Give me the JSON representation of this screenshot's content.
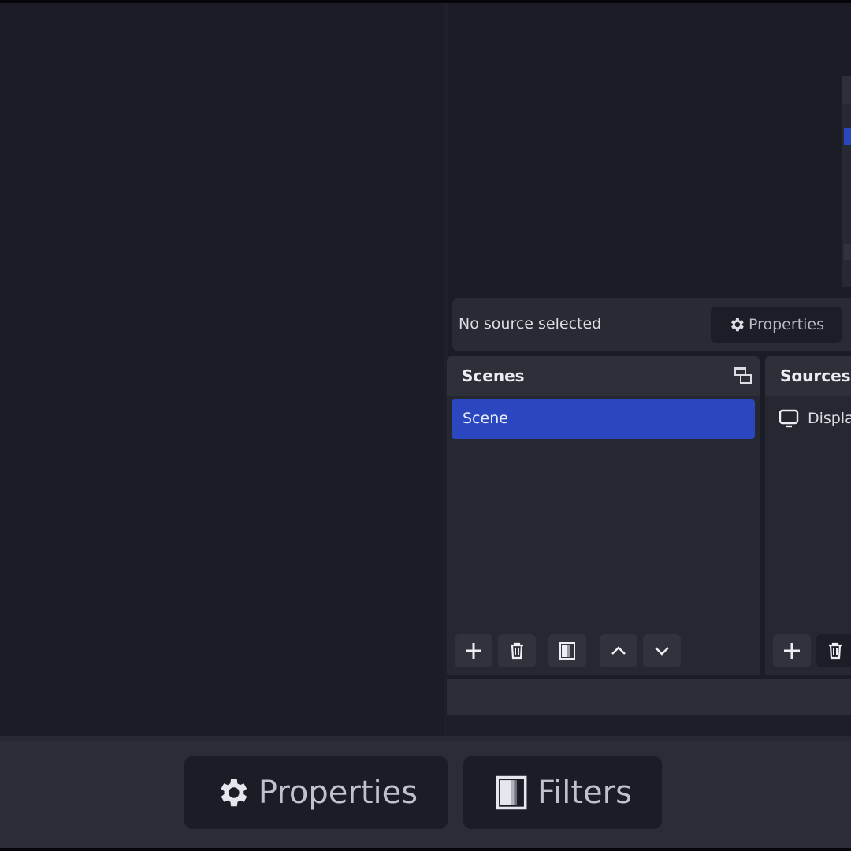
{
  "source_toolbar": {
    "status_text": "No source selected",
    "properties_label": "Properties"
  },
  "scenes_dock": {
    "title": "Scenes",
    "items": [
      {
        "label": "Scene",
        "selected": true
      }
    ],
    "toolbar": [
      "add",
      "remove",
      "filters",
      "move-up",
      "move-down"
    ]
  },
  "sources_dock": {
    "title": "Sources",
    "items": [
      {
        "label": "Displa",
        "icon": "monitor-icon"
      }
    ],
    "toolbar": [
      "add",
      "remove"
    ]
  },
  "footer": {
    "properties_label": "Properties",
    "filters_label": "Filters"
  },
  "colors": {
    "accent_selected": "#2a47c0",
    "background": "#1b1c26",
    "panel": "#262831"
  }
}
